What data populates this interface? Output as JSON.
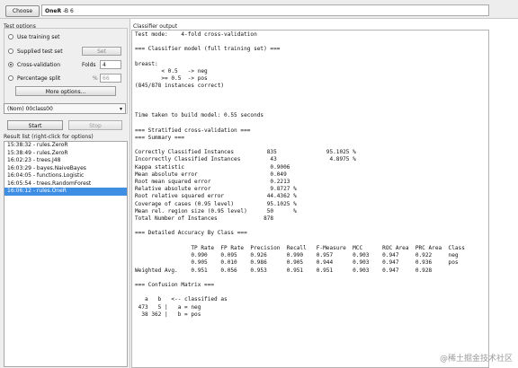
{
  "top": {
    "choose_label": "Choose",
    "classifier_name": "OneR",
    "classifier_args": "-B 6"
  },
  "test_options": {
    "title": "Test options",
    "use_training": "Use training set",
    "supplied": "Supplied test set",
    "set_label": "Set",
    "cross_validation": "Cross-validation",
    "folds_label": "Folds",
    "folds_value": "4",
    "percentage": "Percentage split",
    "percent_sign": "%",
    "percent_value": "66",
    "selected_option": "cross_validation",
    "more_options": "More options..."
  },
  "class_select": {
    "value": "(Nom) 00class00",
    "arrow_icon": "chevron-down-icon"
  },
  "actions": {
    "start": "Start",
    "stop": "Stop"
  },
  "result_list": {
    "title": "Result list (right-click for options)",
    "items": [
      "15:38:32 - rules.ZeroR",
      "15:38:49 - rules.ZeroR",
      "16:02:23 - trees.J48",
      "16:03:29 - bayes.NaiveBayes",
      "16:04:05 - functions.Logistic",
      "16:05:54 - trees.RandomForest",
      "16:06:12 - rules.OneR"
    ],
    "selected_index": 6
  },
  "output": {
    "title": "Classifier output",
    "lines": [
      "Test mode:    4-fold cross-validation",
      "",
      "=== Classifier model (full training set) ===",
      "",
      "breast:",
      "        < 0.5   -> neg",
      "        >= 0.5  -> pos",
      "(845/878 instances correct)",
      "",
      "",
      "",
      "Time taken to build model: 0.55 seconds",
      "",
      "=== Stratified cross-validation ===",
      "=== Summary ===",
      "",
      "Correctly Classified Instances          835               95.1025 %",
      "Incorrectly Classified Instances         43                4.8975 %",
      "Kappa statistic                          0.9006",
      "Mean absolute error                      0.049",
      "Root mean squared error                  0.2213",
      "Relative absolute error                  9.8727 %",
      "Root relative squared error             44.4362 %",
      "Coverage of cases (0.95 level)          95.1025 %",
      "Mean rel. region size (0.95 level)      50      %",
      "Total Number of Instances              878",
      "",
      "=== Detailed Accuracy By Class ===",
      "",
      "                 TP Rate  FP Rate  Precision  Recall   F-Measure  MCC      ROC Area  PRC Area  Class",
      "                 0.990    0.095    0.926      0.990    0.957      0.903    0.947     0.922     neg",
      "                 0.905    0.010    0.986      0.905    0.944      0.903    0.947     0.936     pos",
      "Weighted Avg.    0.951    0.056    0.953      0.951    0.951      0.903    0.947     0.928",
      "",
      "=== Confusion Matrix ===",
      "",
      "   a   b   <-- classified as",
      " 473   5 |   a = neg",
      "  38 362 |   b = pos"
    ]
  },
  "watermark": "@稀土掘金技术社区"
}
